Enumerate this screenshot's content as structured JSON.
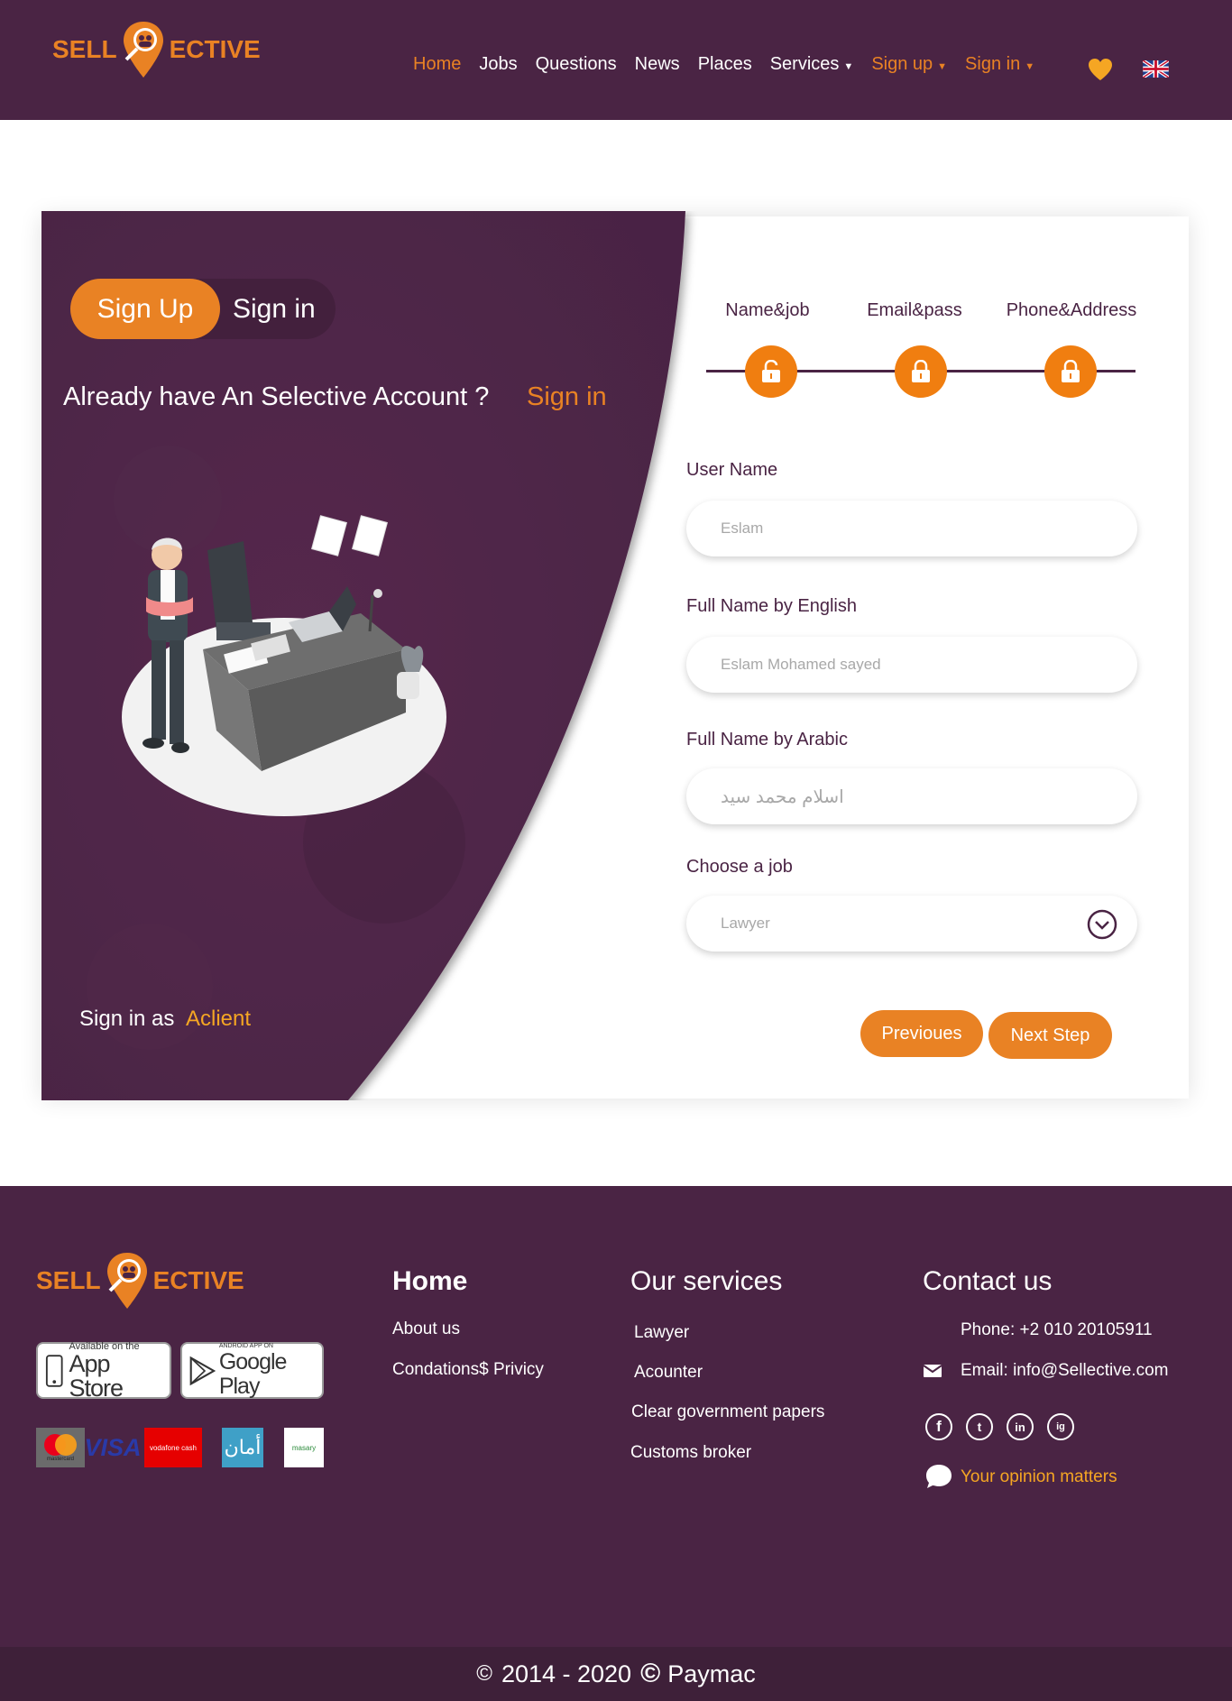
{
  "brand": {
    "logo_left": "SELL",
    "logo_right": "ECTIVE"
  },
  "nav": {
    "items": [
      "Home",
      "Jobs",
      "Questions",
      "News",
      "Places"
    ],
    "services": "Services",
    "sign_up": "Sign up",
    "sign_in": "Sign in",
    "active": "Home"
  },
  "panel": {
    "toggle_active": "Sign Up",
    "toggle_inactive": "Sign in",
    "already_text": "Already have An Selective Account ?",
    "already_link": "Sign in",
    "signin_as": "Sign in as",
    "signin_as_link": "Aclient"
  },
  "steps": [
    {
      "label": "Name&job",
      "icon": "lock-open-icon"
    },
    {
      "label": "Email&pass",
      "icon": "lock-icon"
    },
    {
      "label": "Phone&Address",
      "icon": "lock-icon"
    }
  ],
  "form": {
    "username": {
      "label": "User Name",
      "placeholder": "Eslam"
    },
    "fullname_en": {
      "label": "Full Name by English",
      "placeholder": "Eslam Mohamed sayed"
    },
    "fullname_ar": {
      "label": "Full Name by Arabic",
      "placeholder": "اسلام محمد سيد"
    },
    "job": {
      "label": "Choose a job",
      "value": "Lawyer"
    },
    "prev_button": "Previoues",
    "next_button": "Next Step"
  },
  "footer": {
    "app_store_small": "Available on the",
    "app_store_big": "App Store",
    "google_small": "ANDROID APP ON",
    "google_big": "Google Play",
    "payments": {
      "mastercard": "mastercard",
      "visa": "VISA",
      "vodafone": "vodafone cash",
      "aman": "أمان",
      "masary": "masary"
    },
    "home": {
      "heading": "Home",
      "links": [
        "About us",
        "Condations$ Privicy"
      ]
    },
    "services": {
      "heading": "Our services",
      "links": [
        "Lawyer",
        "Acounter",
        "Clear government papers",
        "Customs broker"
      ]
    },
    "contact": {
      "heading": "Contact us",
      "phone": "Phone: +2 010 20105911",
      "email": "Email: info@Sellective.com",
      "opinion": "Your opinion matters",
      "social": [
        "f",
        "t",
        "in",
        "ig"
      ]
    },
    "copyright": "2014 - 2020",
    "company": "Paymac"
  },
  "colors": {
    "brand_purple": "#4a2444",
    "accent_orange": "#e98224",
    "step_orange": "#f07e10",
    "link_yellow": "#f5a623"
  }
}
